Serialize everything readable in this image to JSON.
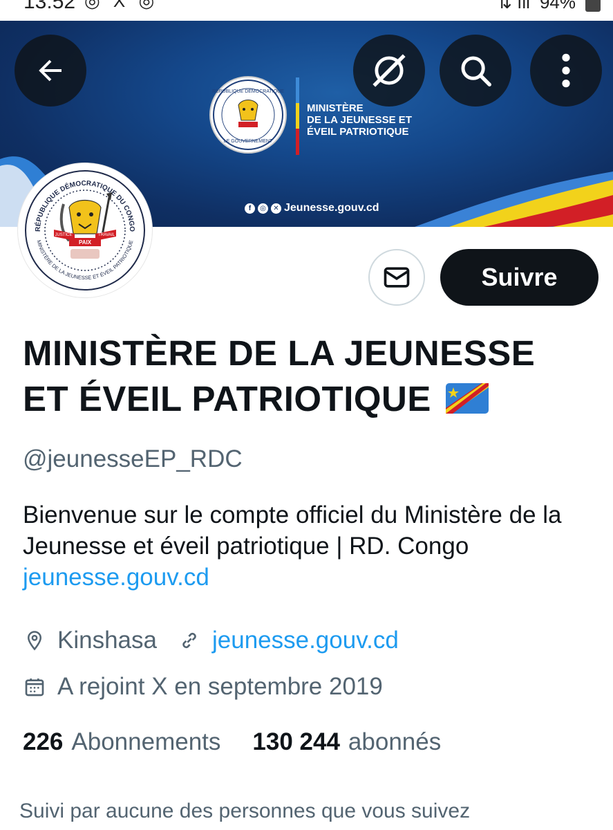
{
  "status_bar": {
    "time": "13:52",
    "apps": "◎ X ◎",
    "battery": "94%"
  },
  "banner": {
    "ministry_title_line1": "MINISTÈRE",
    "ministry_title_line2": "DE LA JEUNESSE ET",
    "ministry_title_line3": "ÉVEIL PATRIOTIQUE",
    "website": "Jeunesse.gouv.cd",
    "seal_top_text": "RÉPUBLIQUE DÉMOCRATIQUE DU CONGO",
    "seal_bottom_text": "LE GOUVERNEMENT"
  },
  "avatar": {
    "ring_text_top": "RÉPUBLIQUE DÉMOCRATIQUE DU CONGO",
    "ring_text_bottom": "MINISTÈRE DE LA JEUNESSE ET ÉVEIL PATRIOTIQUE",
    "ribbon_left": "JUSTICE",
    "ribbon_right": "TRAVAIL",
    "ribbon_bottom": "PAIX"
  },
  "toolbar": {
    "back_icon": "arrow-left-icon",
    "grok_icon": "slash-circle-icon",
    "search_icon": "search-icon",
    "more_icon": "more-vertical-icon"
  },
  "actions": {
    "follow_label": "Suivre",
    "message_icon": "envelope-icon"
  },
  "profile": {
    "name": "MINISTÈRE DE LA JEUNESSE ET ÉVEIL PATRIOTIQUE",
    "handle": "@jeunesseEP_RDC",
    "bio": "Bienvenue sur le compte officiel du Ministère de la Jeunesse et éveil patriotique | RD. Congo",
    "bio_link": "jeunesse.gouv.cd",
    "location": "Kinshasa",
    "website": "jeunesse.gouv.cd",
    "joined": "A rejoint X en septembre 2019",
    "following_count": "226",
    "following_label": "Abonnements",
    "followers_count": "130 244",
    "followers_label": "abonnés",
    "followed_by": "Suivi par aucune des personnes que vous suivez"
  },
  "colors": {
    "accent": "#1d9bf0",
    "text": "#0f1419",
    "muted": "#536471",
    "button_dark": "#0f1419"
  }
}
